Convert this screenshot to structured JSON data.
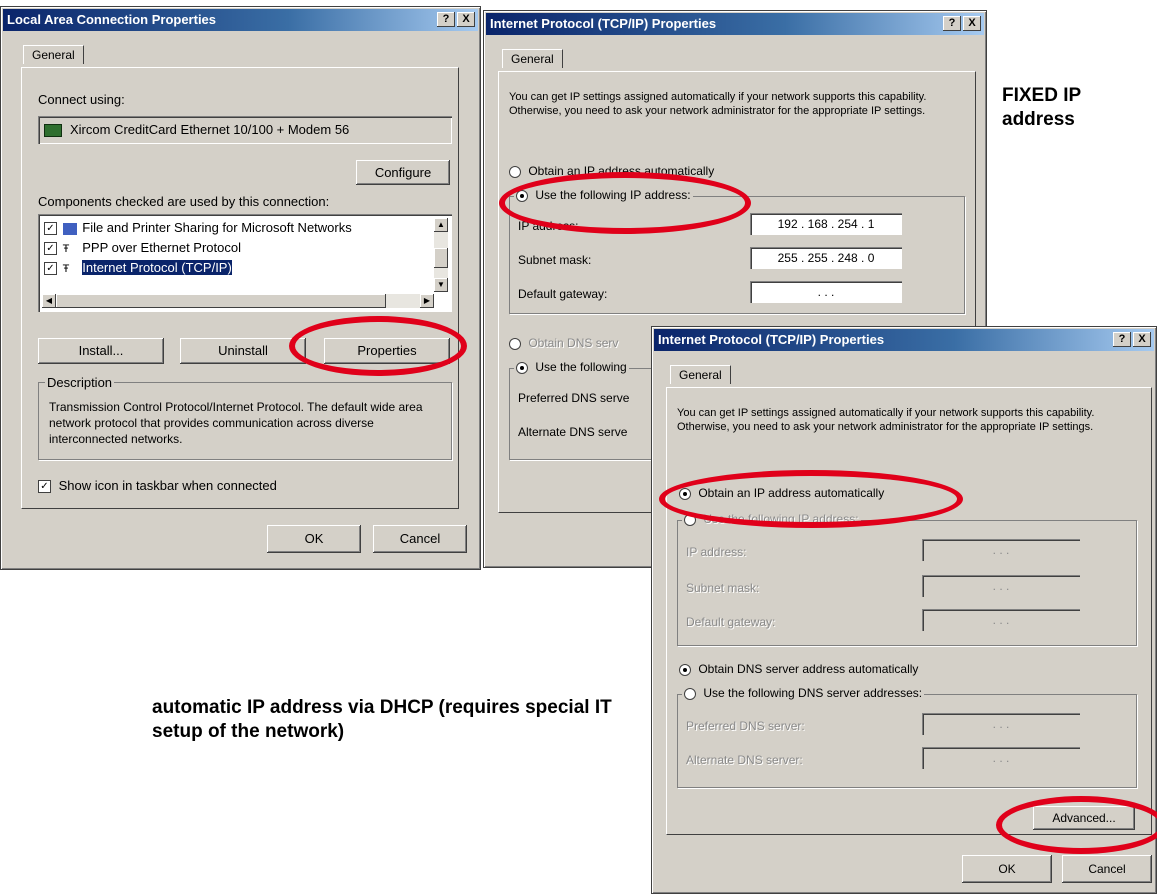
{
  "lac": {
    "title": "Local Area Connection Properties",
    "help_btn": "?",
    "close_btn": "X",
    "tab": "General",
    "connect_using_label": "Connect using:",
    "adapter": "Xircom CreditCard Ethernet 10/100 + Modem 56",
    "configure_btn": "Configure",
    "components_label": "Components checked are used by this connection:",
    "components": [
      "File and Printer Sharing for Microsoft Networks",
      "PPP over Ethernet Protocol",
      "Internet Protocol (TCP/IP)"
    ],
    "install_btn": "Install...",
    "uninstall_btn": "Uninstall",
    "properties_btn": "Properties",
    "description_label": "Description",
    "description_text": "Transmission Control Protocol/Internet Protocol. The default wide area network protocol that provides communication across diverse interconnected networks.",
    "show_icon_label": "Show icon in taskbar when connected",
    "ok_btn": "OK",
    "cancel_btn": "Cancel"
  },
  "tcp1": {
    "title": "Internet Protocol (TCP/IP) Properties",
    "help_btn": "?",
    "close_btn": "X",
    "tab": "General",
    "intro": "You can get IP settings assigned automatically if your network supports this capability. Otherwise, you need to ask your network administrator for the appropriate IP settings.",
    "obtain_ip": "Obtain an IP address automatically",
    "use_ip": "Use the following IP address:",
    "ip_label": "IP address:",
    "ip_value": "192 . 168 . 254 .  1",
    "subnet_label": "Subnet mask:",
    "subnet_value": "255 . 255 . 248 .  0",
    "gateway_label": "Default gateway:",
    "gateway_value": " .     .     . ",
    "obtain_dns": "Obtain DNS serv",
    "use_dns": "Use the following",
    "preferred_dns": "Preferred DNS serve",
    "alternate_dns": "Alternate DNS serve"
  },
  "tcp2": {
    "title": "Internet Protocol (TCP/IP) Properties",
    "help_btn": "?",
    "close_btn": "X",
    "tab": "General",
    "intro": "You can get IP settings assigned automatically if your network supports this capability. Otherwise, you need to ask your network administrator for the appropriate IP settings.",
    "obtain_ip": "Obtain an IP address automatically",
    "use_ip": "Use the following IP address:",
    "ip_label": "IP address:",
    "subnet_label": "Subnet mask:",
    "gateway_label": "Default gateway:",
    "obtain_dns": "Obtain DNS server address automatically",
    "use_dns": "Use the following DNS server addresses:",
    "preferred_dns": "Preferred DNS server:",
    "alternate_dns": "Alternate DNS server:",
    "empty_ip": " .     .     . ",
    "advanced_btn": "Advanced...",
    "ok_btn": "OK",
    "cancel_btn": "Cancel"
  },
  "captions": {
    "fixed": "FIXED IP address",
    "automatic": "automatic IP address via DHCP (requires special IT setup of the network)"
  },
  "colors": {
    "highlight_ellipse": "#e0001a",
    "title_bar": "#0a246a",
    "dialog_face": "#d4d0c8"
  }
}
